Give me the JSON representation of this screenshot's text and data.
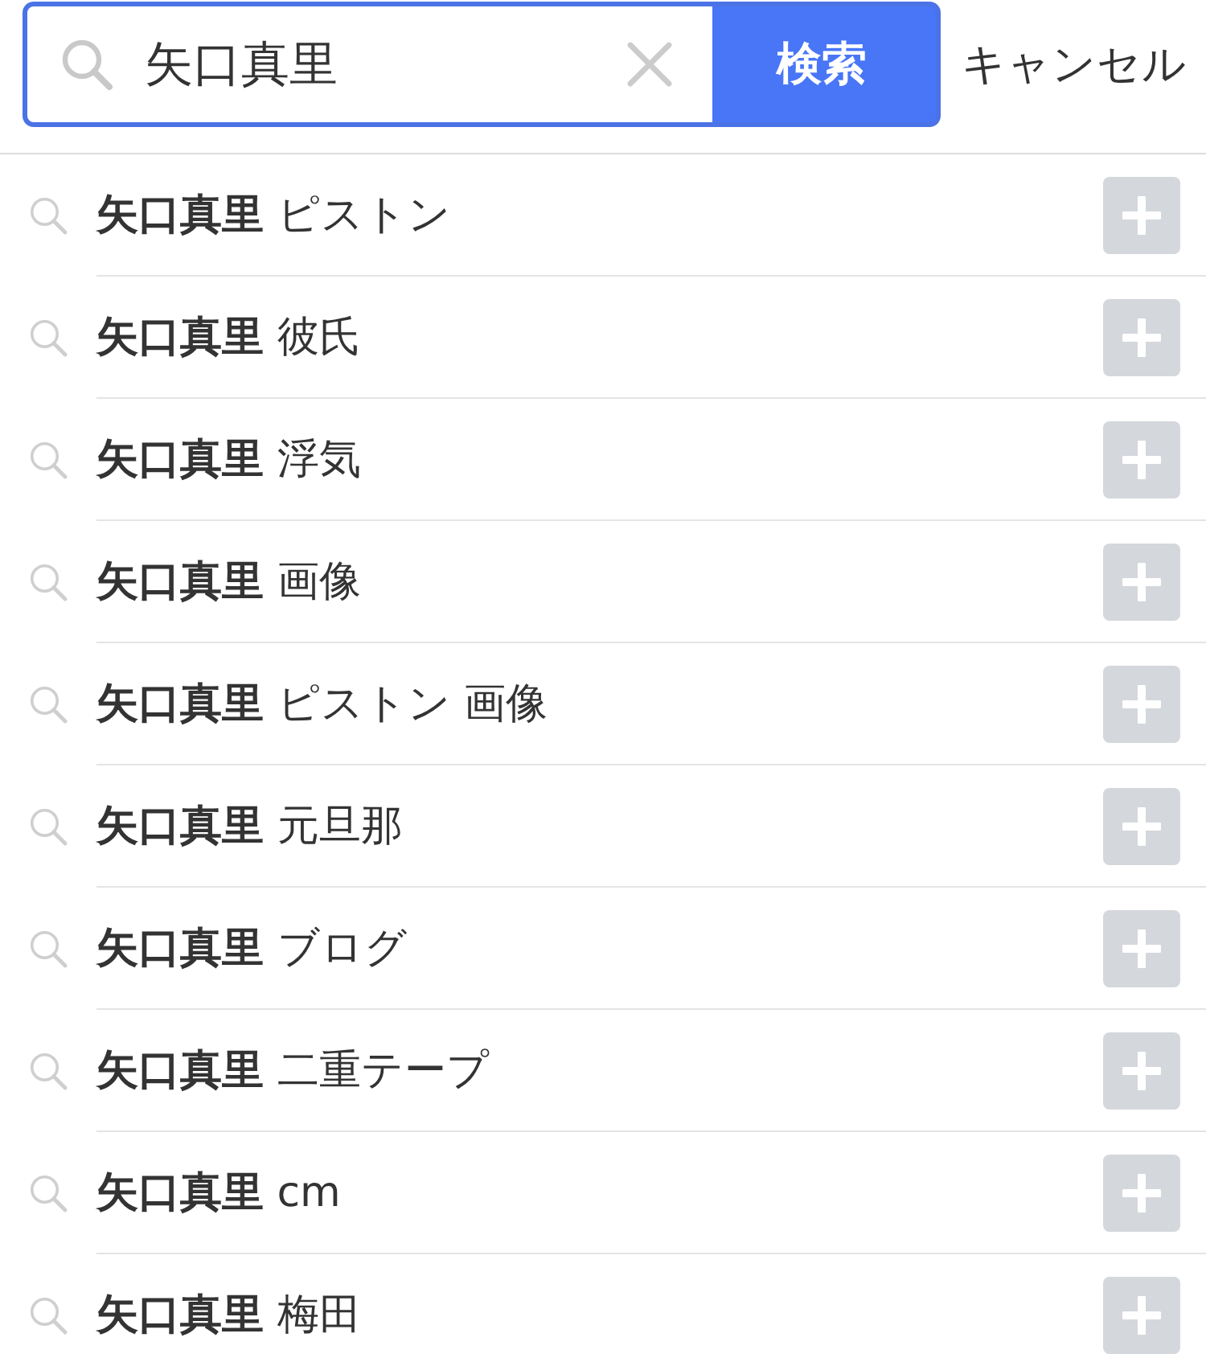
{
  "search": {
    "value": "矢口真里",
    "button": "検索",
    "cancel": "キャンセル"
  },
  "suggestions": [
    {
      "text": "**矢口真里** ピストン"
    },
    {
      "text": "**矢口真里** 彼氏"
    },
    {
      "text": "**矢口真里** 浮気"
    },
    {
      "text": "**矢口真里** 画像"
    },
    {
      "text": "**矢口真里** ピストン 画像"
    },
    {
      "text": "**矢口真里** 元旦那"
    },
    {
      "text": "**矢口真里** ブログ"
    },
    {
      "text": "**矢口真里** 二重テープ"
    },
    {
      "text": "**矢口真里** cm"
    },
    {
      "text": "**矢口真里** 梅田"
    }
  ]
}
